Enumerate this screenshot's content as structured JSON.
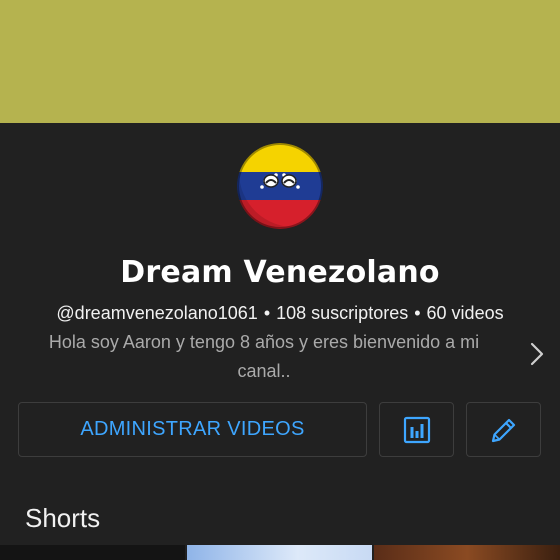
{
  "channel": {
    "name": "Dream Venezolano",
    "handle": "@dreamvenezolano1061",
    "subscribers": "108 suscriptores",
    "videos": "60 videos",
    "separator": "•",
    "description": "Hola soy Aaron y tengo 8 años y eres bienvenido a mi canal.."
  },
  "actions": {
    "manage_label": "ADMINISTRAR VIDEOS",
    "analytics_icon": "analytics-icon",
    "edit_icon": "pencil-icon"
  },
  "sections": {
    "shorts_title": "Shorts"
  },
  "colors": {
    "background": "#212121",
    "banner": "#b5b34f",
    "accent_blue": "#3ea6ff",
    "text_primary": "#ffffff",
    "text_secondary": "#aaaaaa",
    "flag_yellow": "#f5d300",
    "flag_blue": "#1f3c94",
    "flag_red": "#d6202c"
  }
}
